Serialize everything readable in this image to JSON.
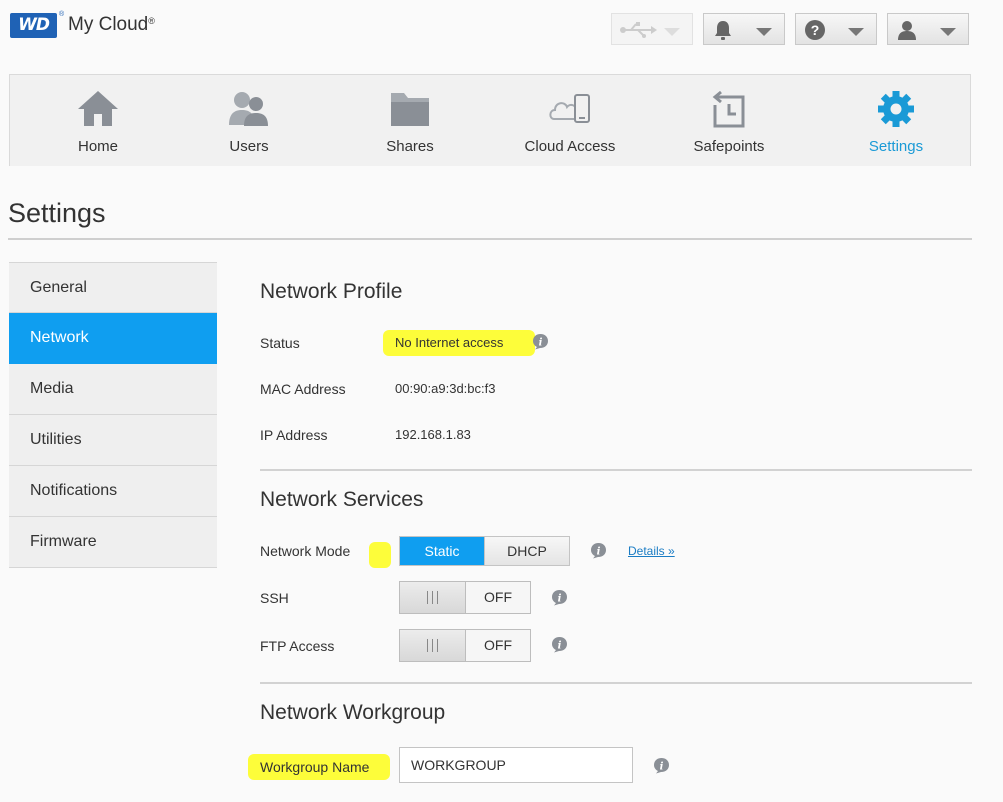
{
  "header": {
    "logo_text": "WD",
    "logo_tm": "®",
    "brand": "My Cloud",
    "brand_reg": "®",
    "buttons": [
      {
        "icon": "usb-icon",
        "disabled": true
      },
      {
        "icon": "bell-icon"
      },
      {
        "icon": "help-icon",
        "glyph": "?"
      },
      {
        "icon": "user-icon"
      }
    ]
  },
  "nav": {
    "items": [
      {
        "label": "Home",
        "icon": "home-icon"
      },
      {
        "label": "Users",
        "icon": "users-icon"
      },
      {
        "label": "Shares",
        "icon": "folder-icon"
      },
      {
        "label": "Cloud Access",
        "icon": "cloud-device-icon"
      },
      {
        "label": "Safepoints",
        "icon": "safepoint-icon"
      },
      {
        "label": "Settings",
        "icon": "gear-icon",
        "active": true
      }
    ]
  },
  "page": {
    "title": "Settings"
  },
  "sidemenu": {
    "items": [
      {
        "label": "General"
      },
      {
        "label": "Network",
        "active": true
      },
      {
        "label": "Media"
      },
      {
        "label": "Utilities"
      },
      {
        "label": "Notifications"
      },
      {
        "label": "Firmware"
      }
    ]
  },
  "profile": {
    "title": "Network Profile",
    "status_label": "Status",
    "status_value": "No Internet access",
    "mac_label": "MAC Address",
    "mac_value": "00:90:a9:3d:bc:f3",
    "ip_label": "IP Address",
    "ip_value": "192.168.1.83"
  },
  "services": {
    "title": "Network Services",
    "mode_label": "Network Mode",
    "mode_options": [
      "Static",
      "DHCP"
    ],
    "mode_selected": "Static",
    "details_link": "Details »",
    "ssh_label": "SSH",
    "ssh_state": "OFF",
    "ftp_label": "FTP Access",
    "ftp_state": "OFF"
  },
  "workgroup": {
    "title": "Network Workgroup",
    "name_label": "Workgroup Name",
    "name_value": "WORKGROUP"
  },
  "colors": {
    "accent": "#0f9ef0",
    "active_nav_text": "#1a9ad6",
    "highlight": "#fdfd3a",
    "logo_bg": "#1f62b5",
    "link": "#1a7cc4"
  }
}
